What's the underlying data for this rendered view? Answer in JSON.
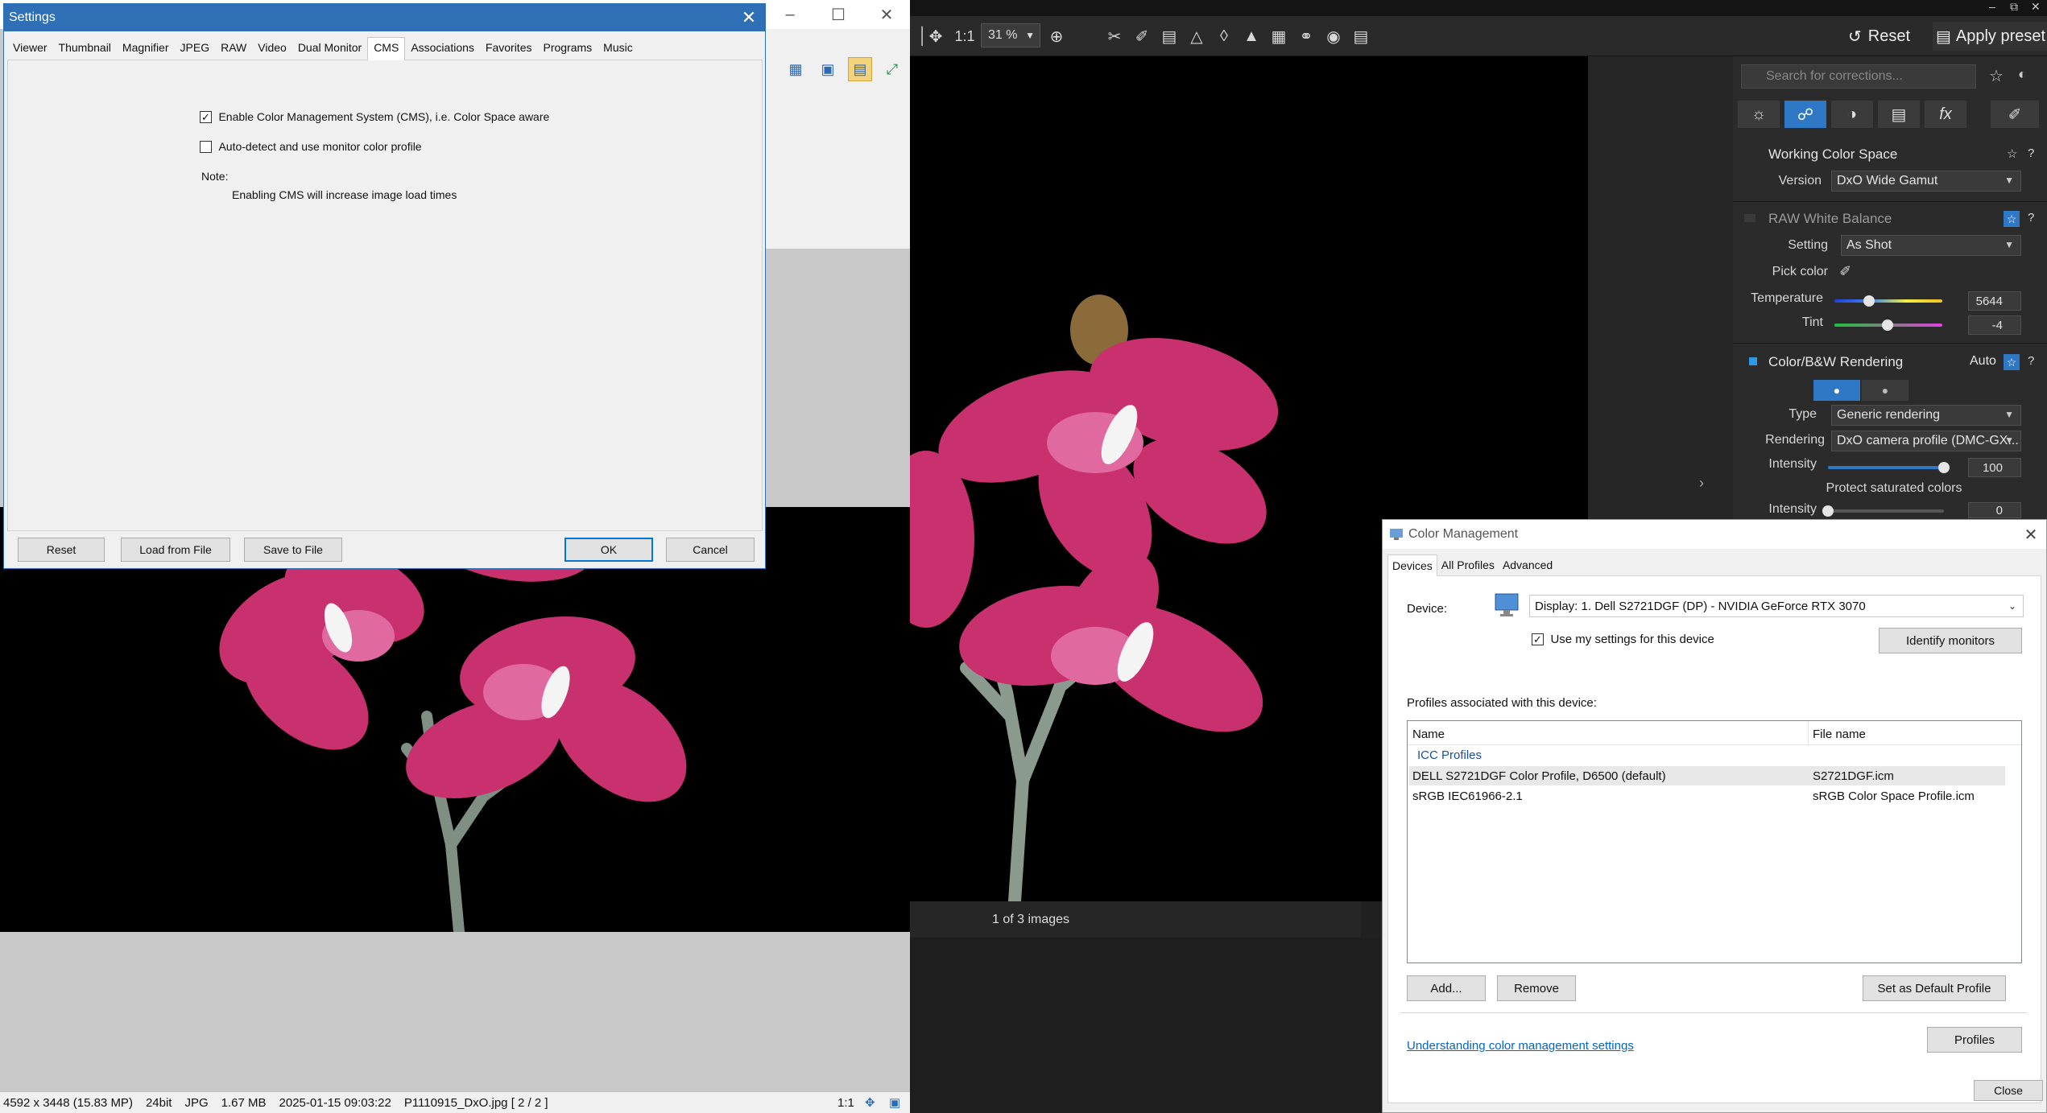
{
  "settings": {
    "title": "Settings",
    "tabs": [
      "Viewer",
      "Thumbnail",
      "Magnifier",
      "JPEG",
      "RAW",
      "Video",
      "Dual Monitor",
      "CMS",
      "Associations",
      "Favorites",
      "Programs",
      "Music"
    ],
    "active_tab": "CMS",
    "enable_cms_label": "Enable Color Management System (CMS), i.e. Color Space aware",
    "enable_cms_checked": true,
    "autodetect_label": "Auto-detect and use monitor color profile",
    "autodetect_checked": false,
    "note_label": "Note:",
    "note_text": "Enabling CMS will increase image load times",
    "buttons": {
      "reset": "Reset",
      "load": "Load from File",
      "save": "Save to File",
      "ok": "OK",
      "cancel": "Cancel"
    }
  },
  "viewer": {
    "status": {
      "dims": "4592 x 3448 (15.83 MP)",
      "bits": "24bit",
      "format": "JPG",
      "size": "1.67 MB",
      "datetime": "2025-01-15 09:03:22",
      "file": "P1110915_DxO.jpg [ 2 / 2 ]",
      "zoom": "1:1"
    }
  },
  "dxo": {
    "toolbar": {
      "ratio": "1:1",
      "zoom": "31 %",
      "reset": "Reset",
      "apply_preset": "Apply preset"
    },
    "search_placeholder": "Search for corrections...",
    "filmstrip": "1 of 3 images",
    "working_color_space": {
      "title": "Working Color Space",
      "version_label": "Version",
      "version_value": "DxO Wide Gamut",
      "help": "?"
    },
    "raw_white_balance": {
      "title": "RAW White Balance",
      "setting_label": "Setting",
      "setting_value": "As Shot",
      "pick_color_label": "Pick color",
      "temperature_label": "Temperature",
      "temperature_value": "5644",
      "temperature_level": 0.32,
      "tint_label": "Tint",
      "tint_value": "-4",
      "tint_level": 0.49,
      "help": "?"
    },
    "color_bw_rendering": {
      "title": "Color/B&W Rendering",
      "auto_label": "Auto",
      "type_label": "Type",
      "type_value": "Generic rendering",
      "rendering_label": "Rendering",
      "rendering_value": "DxO camera profile (DMC-GX...",
      "intensity_label": "Intensity",
      "intensity_value": "100",
      "intensity_level": 1.0,
      "protect_label": "Protect saturated colors",
      "intensity2_label": "Intensity",
      "intensity2_value": "0",
      "intensity2_level": 0.0,
      "help": "?"
    }
  },
  "color_management": {
    "title": "Color Management",
    "tabs": [
      "Devices",
      "All Profiles",
      "Advanced"
    ],
    "device_label": "Device:",
    "device_value": "Display: 1. Dell S2721DGF (DP) - NVIDIA GeForce RTX 3070",
    "use_settings_label": "Use my settings for this device",
    "use_settings_checked": true,
    "identify_button": "Identify monitors",
    "profiles_label": "Profiles associated with this device:",
    "columns": {
      "name": "Name",
      "file": "File name"
    },
    "group": "ICC Profiles",
    "rows": [
      {
        "name": "DELL S2721DGF Color Profile, D6500 (default)",
        "file": "S2721DGF.icm"
      },
      {
        "name": "sRGB IEC61966-2.1",
        "file": "sRGB Color Space Profile.icm"
      }
    ],
    "buttons": {
      "add": "Add...",
      "remove": "Remove",
      "set_default": "Set as Default Profile",
      "profiles": "Profiles",
      "close": "Close"
    },
    "link": "Understanding color management settings"
  }
}
